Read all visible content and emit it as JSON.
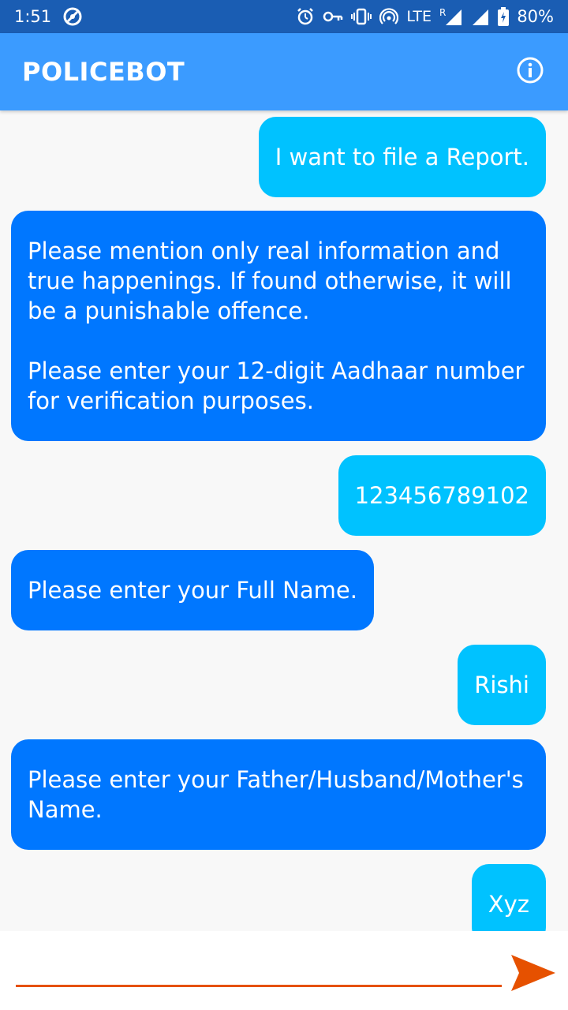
{
  "status_bar": {
    "time": "1:51",
    "network": "LTE",
    "roaming": "R",
    "battery": "80%"
  },
  "app_bar": {
    "title": "POLICEBOT",
    "info_icon": "info-circle-icon"
  },
  "messages": [
    {
      "from": "user",
      "text": "I want to file a Report."
    },
    {
      "from": "bot",
      "text": "Please mention only real information and\ntrue happenings. If found otherwise, it will\nbe a punishable offence.\n\nPlease enter your 12-digit Aadhaar number\nfor verification purposes."
    },
    {
      "from": "user",
      "text": "123456789102"
    },
    {
      "from": "bot",
      "text": "Please enter your Full Name."
    },
    {
      "from": "user",
      "text": "Rishi"
    },
    {
      "from": "bot",
      "text": "Please enter your Father/Husband/Mother's\nName."
    },
    {
      "from": "user",
      "text": "Xyz"
    }
  ],
  "input": {
    "value": "",
    "placeholder": ""
  },
  "send_icon": "send-arrow-icon",
  "colors": {
    "status_bar": "#1a5db3",
    "app_bar": "#3b9bff",
    "user_bubble": "#00c2ff",
    "bot_bubble": "#0077ff",
    "accent": "#e65100"
  }
}
